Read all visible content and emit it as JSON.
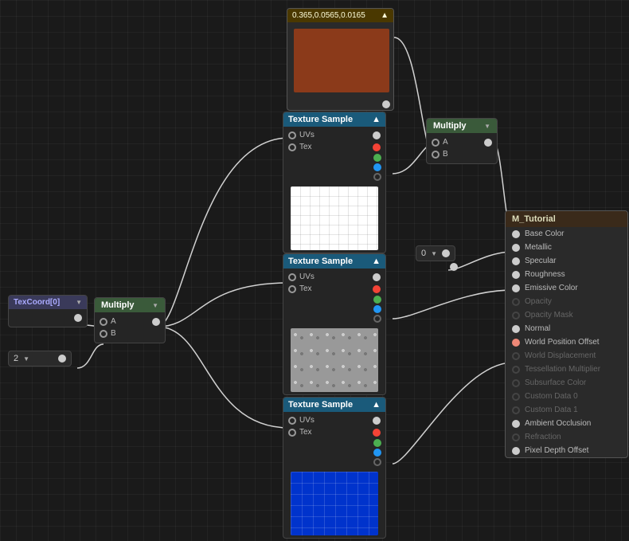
{
  "canvas": {
    "background": "#1a1a1a"
  },
  "nodes": {
    "constant": {
      "label": "0.365,0.0565,0.0165",
      "color": "#8B3A1A"
    },
    "texcoord": {
      "label": "TexCoord[0]"
    },
    "multiply1": {
      "label": "Multiply",
      "pins": [
        "A",
        "B"
      ]
    },
    "multiply2": {
      "label": "Multiply",
      "pins": [
        "A",
        "B"
      ]
    },
    "value0": {
      "label": "0"
    },
    "value2": {
      "label": "2"
    },
    "texSample1": {
      "label": "Texture Sample",
      "pins_in": [
        "UVs",
        "Tex"
      ],
      "preview": "white-grid"
    },
    "texSample2": {
      "label": "Texture Sample",
      "pins_in": [
        "UVs",
        "Tex"
      ],
      "preview": "gray"
    },
    "texSample3": {
      "label": "Texture Sample",
      "pins_in": [
        "UVs",
        "Tex"
      ],
      "preview": "blue-grid"
    }
  },
  "materialPanel": {
    "title": "M_Tutorial",
    "pins": [
      {
        "label": "Base Color",
        "state": "active"
      },
      {
        "label": "Metallic",
        "state": "active"
      },
      {
        "label": "Specular",
        "state": "active"
      },
      {
        "label": "Roughness",
        "state": "active"
      },
      {
        "label": "Emissive Color",
        "state": "active"
      },
      {
        "label": "Opacity",
        "state": "dim"
      },
      {
        "label": "Opacity Mask",
        "state": "dim"
      },
      {
        "label": "Normal",
        "state": "active"
      },
      {
        "label": "World Position Offset",
        "state": "orange"
      },
      {
        "label": "World Displacement",
        "state": "dim"
      },
      {
        "label": "Tessellation Multiplier",
        "state": "dim"
      },
      {
        "label": "Subsurface Color",
        "state": "dim"
      },
      {
        "label": "Custom Data 0",
        "state": "dim"
      },
      {
        "label": "Custom Data 1",
        "state": "dim"
      },
      {
        "label": "Ambient Occlusion",
        "state": "active"
      },
      {
        "label": "Refraction",
        "state": "dim"
      },
      {
        "label": "Pixel Depth Offset",
        "state": "active"
      }
    ]
  }
}
